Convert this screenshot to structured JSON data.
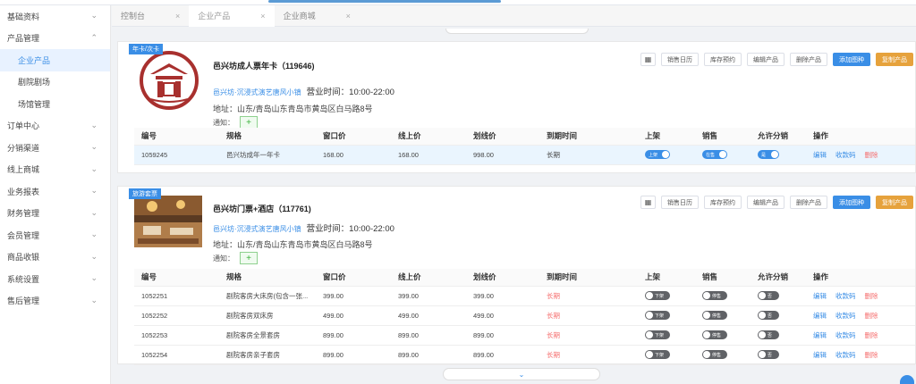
{
  "sidebar": {
    "items": [
      {
        "label": "基础资料",
        "chevron": "⌄"
      },
      {
        "label": "产品管理",
        "chevron": "⌃"
      },
      {
        "label": "企业产品",
        "chevron": ""
      },
      {
        "label": "剧院剧场",
        "chevron": ""
      },
      {
        "label": "场馆管理",
        "chevron": ""
      },
      {
        "label": "订单中心",
        "chevron": "⌄"
      },
      {
        "label": "分销渠道",
        "chevron": "⌄"
      },
      {
        "label": "线上商城",
        "chevron": "⌄"
      },
      {
        "label": "业务报表",
        "chevron": "⌄"
      },
      {
        "label": "财务管理",
        "chevron": "⌄"
      },
      {
        "label": "会员管理",
        "chevron": "⌄"
      },
      {
        "label": "商品收银",
        "chevron": "⌄"
      },
      {
        "label": "系统设置",
        "chevron": "⌄"
      },
      {
        "label": "售后管理",
        "chevron": "⌄"
      }
    ]
  },
  "tabs": [
    {
      "label": "控制台",
      "close": "×"
    },
    {
      "label": "企业产品",
      "close": "×"
    },
    {
      "label": "企业商城",
      "close": "×"
    }
  ],
  "columns": [
    "编号",
    "规格",
    "窗口价",
    "线上价",
    "划线价",
    "到期时间",
    "上架",
    "销售",
    "允许分销",
    "操作"
  ],
  "actions": {
    "qr": "▦",
    "calendar": "销售日历",
    "stock": "库存预约",
    "edit": "编辑产品",
    "delete": "删除产品",
    "add_spec": "添加图种",
    "copy": "复制产品"
  },
  "row_ops": {
    "edit": "编辑",
    "qr": "收款码",
    "del": "删除"
  },
  "products": [
    {
      "tag": "年卡/次卡",
      "title": "邑兴坊成人票年卡（119646)",
      "sub_link": "邑兴坊·沉浸式演艺唐风小镇",
      "hours": "营业时间：10:00-22:00",
      "addr": "地址：山东/青岛山东青岛市黄岛区白马路8号",
      "notify": "通知：",
      "notify_btn": "+",
      "rows": [
        {
          "id": "1059245",
          "spec": "邑兴坊成年一年卡",
          "window": "168.00",
          "online": "168.00",
          "strike": "998.00",
          "expire": "长期",
          "listed": "上架",
          "sale": "在售",
          "dist": "是"
        }
      ]
    },
    {
      "tag": "旅游套票",
      "title": "邑兴坊门票+酒店（117761)",
      "sub_link": "邑兴坊·沉浸式演艺唐风小镇",
      "hours": "营业时间：10:00-22:00",
      "addr": "地址：山东/青岛山东青岛市黄岛区白马路8号",
      "notify": "通知：",
      "notify_btn": "+",
      "rows": [
        {
          "id": "1052251",
          "spec": "剧院客房大床房(包含一张...",
          "window": "399.00",
          "online": "399.00",
          "strike": "399.00",
          "expire": "长期",
          "listed": "下架",
          "sale": "停售",
          "dist": "否"
        },
        {
          "id": "1052252",
          "spec": "剧院客房双床房",
          "window": "499.00",
          "online": "499.00",
          "strike": "499.00",
          "expire": "长期",
          "listed": "下架",
          "sale": "停售",
          "dist": "否"
        },
        {
          "id": "1052253",
          "spec": "剧院客房全景套房",
          "window": "899.00",
          "online": "899.00",
          "strike": "899.00",
          "expire": "长期",
          "listed": "下架",
          "sale": "停售",
          "dist": "否"
        },
        {
          "id": "1052254",
          "spec": "剧院客房亲子套房",
          "window": "899.00",
          "online": "899.00",
          "strike": "899.00",
          "expire": "长期",
          "listed": "下架",
          "sale": "停售",
          "dist": "否"
        }
      ]
    }
  ],
  "bottom_toggle": "⌄",
  "logo_text": "邑兴坊"
}
